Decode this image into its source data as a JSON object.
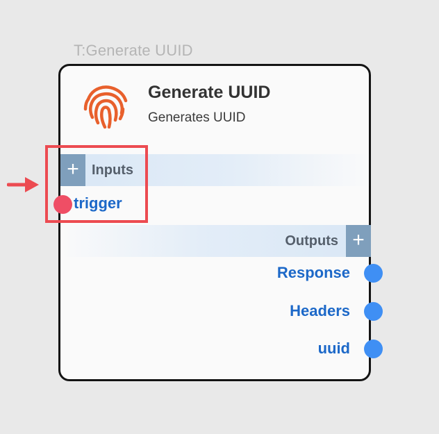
{
  "node": {
    "type_label": "T:Generate UUID",
    "title": "Generate UUID",
    "subtitle": "Generates UUID",
    "logo_icon": "fingerprint-icon",
    "accent_color": "#e8602c"
  },
  "inputs": {
    "label": "Inputs",
    "add_label": "+",
    "ports": [
      {
        "label": "trigger"
      }
    ]
  },
  "outputs": {
    "label": "Outputs",
    "add_label": "+",
    "ports": [
      {
        "label": "Response"
      },
      {
        "label": "Headers"
      },
      {
        "label": "uuid"
      }
    ]
  },
  "annotation": {
    "highlight_color": "#ec4b51",
    "arrow_icon": "arrow-right-icon"
  }
}
